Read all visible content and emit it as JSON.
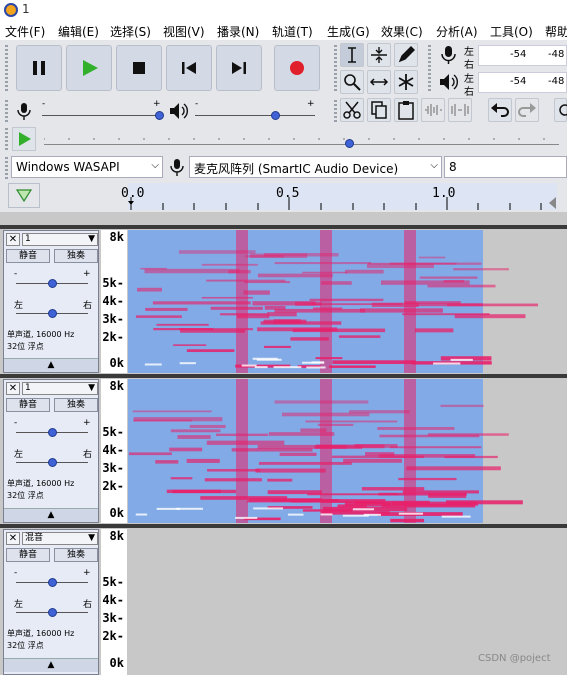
{
  "window": {
    "title": "1"
  },
  "menu": [
    "文件(F)",
    "编辑(E)",
    "选择(S)",
    "视图(V)",
    "播录(N)",
    "轨道(T)",
    "生成(G)",
    "效果(C)",
    "分析(A)",
    "工具(O)",
    "帮助"
  ],
  "transport": {
    "buttons": [
      "pause",
      "play",
      "stop",
      "skip-to-start",
      "skip-to-end",
      "record"
    ]
  },
  "meters": {
    "rec": {
      "left": "左",
      "right": "右",
      "ticks": [
        "-54",
        "-48"
      ]
    },
    "play": {
      "left": "左",
      "right": "右",
      "ticks": [
        "-54",
        "-48"
      ]
    }
  },
  "device": {
    "host": "Windows WASAPI",
    "input": "麦克风阵列 (SmartIC Audio Device)",
    "channels": "8"
  },
  "timeline": {
    "ticks": [
      "0.0",
      "0.5",
      "1.0"
    ]
  },
  "colors": {
    "accent": "#3f63d6",
    "record": "#e0202a",
    "play": "#32b02c",
    "spectro_low": "#e8206a",
    "spectro_high": "#6aa0f0"
  },
  "tracks": [
    {
      "name": "1",
      "mute": "静音",
      "solo": "独奏",
      "gain_min": "-",
      "gain_max": "+",
      "pan_left": "左",
      "pan_right": "右",
      "info1": "单声道, 16000 Hz",
      "info2": "32位 浮点",
      "scale": [
        "8k",
        "5k-",
        "4k-",
        "3k-",
        "2k-",
        "0k"
      ],
      "gain": 0.5,
      "pan": 0.5
    },
    {
      "name": "1",
      "mute": "静音",
      "solo": "独奏",
      "gain_min": "-",
      "gain_max": "+",
      "pan_left": "左",
      "pan_right": "右",
      "info1": "单声道, 16000 Hz",
      "info2": "32位 浮点",
      "scale": [
        "8k",
        "5k-",
        "4k-",
        "3k-",
        "2k-",
        "0k"
      ],
      "gain": 0.5,
      "pan": 0.5
    },
    {
      "name": "混音",
      "mute": "静音",
      "solo": "独奏",
      "gain_min": "-",
      "gain_max": "+",
      "pan_left": "左",
      "pan_right": "右",
      "info1": "单声道, 16000 Hz",
      "info2": "32位 浮点",
      "scale": [
        "8k",
        "5k-",
        "4k-",
        "3k-",
        "2k-",
        "0k"
      ],
      "gain": 0.5,
      "pan": 0.5
    }
  ],
  "watermark": "CSDN @poject"
}
